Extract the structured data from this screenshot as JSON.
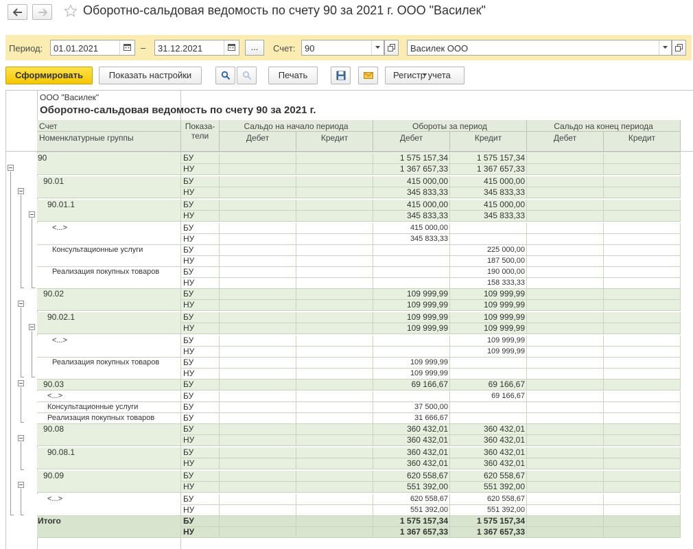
{
  "window": {
    "title": "Оборотно-сальдовая ведомость по счету 90 за 2021 г. ООО \"Василек\""
  },
  "filter": {
    "period_label": "Период:",
    "date_from": "01.01.2021",
    "date_to": "31.12.2021",
    "dash": "–",
    "ellipsis": "...",
    "account_label": "Счет:",
    "account_value": "90",
    "organization_value": "Василек ООО"
  },
  "toolbar": {
    "generate_label": "Сформировать",
    "settings_label": "Показать настройки",
    "print_label": "Печать",
    "register_label": "Регистр учета"
  },
  "report": {
    "org_name": "ООО \"Василек\"",
    "title": "Оборотно-сальдовая ведомость по счету 90 за 2021 г.",
    "headers": {
      "account": "Счет",
      "groups": "Номенклатурные группы",
      "indicators_1": "Показа-",
      "indicators_2": "тели",
      "opening": "Сальдо на начало периода",
      "turnover": "Обороты за период",
      "closing": "Сальдо на конец периода",
      "debit": "Дебет",
      "credit": "Кредит"
    },
    "rows": [
      {
        "label": "90",
        "ind": "БУ",
        "td": "1 575 157,34",
        "tc": "1 575 157,34"
      },
      {
        "label": "",
        "ind": "НУ",
        "td": "1 367 657,33",
        "tc": "1 367 657,33"
      },
      {
        "label": "90.01",
        "ind": "БУ",
        "td": "415 000,00",
        "tc": "415 000,00"
      },
      {
        "label": "",
        "ind": "НУ",
        "td": "345 833,33",
        "tc": "345 833,33"
      },
      {
        "label": "90.01.1",
        "ind": "БУ",
        "td": "415 000,00",
        "tc": "415 000,00"
      },
      {
        "label": "",
        "ind": "НУ",
        "td": "345 833,33",
        "tc": "345 833,33"
      },
      {
        "label": "<...>",
        "ind": "БУ",
        "td": "415 000,00",
        "tc": ""
      },
      {
        "label": "",
        "ind": "НУ",
        "td": "345 833,33",
        "tc": ""
      },
      {
        "label": "Консультационные услуги",
        "ind": "БУ",
        "td": "",
        "tc": "225 000,00"
      },
      {
        "label": "",
        "ind": "НУ",
        "td": "",
        "tc": "187 500,00"
      },
      {
        "label": "Реализация покупных товаров",
        "ind": "БУ",
        "td": "",
        "tc": "190 000,00"
      },
      {
        "label": "",
        "ind": "НУ",
        "td": "",
        "tc": "158 333,33"
      },
      {
        "label": "90.02",
        "ind": "БУ",
        "td": "109 999,99",
        "tc": "109 999,99"
      },
      {
        "label": "",
        "ind": "НУ",
        "td": "109 999,99",
        "tc": "109 999,99"
      },
      {
        "label": "90.02.1",
        "ind": "БУ",
        "td": "109 999,99",
        "tc": "109 999,99"
      },
      {
        "label": "",
        "ind": "НУ",
        "td": "109 999,99",
        "tc": "109 999,99"
      },
      {
        "label": "<...>",
        "ind": "БУ",
        "td": "",
        "tc": "109 999,99"
      },
      {
        "label": "",
        "ind": "НУ",
        "td": "",
        "tc": "109 999,99"
      },
      {
        "label": "Реализация покупных товаров",
        "ind": "БУ",
        "td": "109 999,99",
        "tc": ""
      },
      {
        "label": "",
        "ind": "НУ",
        "td": "109 999,99",
        "tc": ""
      },
      {
        "label": "90.03",
        "ind": "БУ",
        "td": "69 166,67",
        "tc": "69 166,67"
      },
      {
        "label": "<...>",
        "ind": "БУ",
        "td": "",
        "tc": "69 166,67"
      },
      {
        "label": "Консультационные услуги",
        "ind": "БУ",
        "td": "37 500,00",
        "tc": ""
      },
      {
        "label": "Реализация покупных товаров",
        "ind": "БУ",
        "td": "31 666,67",
        "tc": ""
      },
      {
        "label": "90.08",
        "ind": "БУ",
        "td": "360 432,01",
        "tc": "360 432,01"
      },
      {
        "label": "",
        "ind": "НУ",
        "td": "360 432,01",
        "tc": "360 432,01"
      },
      {
        "label": "90.08.1",
        "ind": "БУ",
        "td": "360 432,01",
        "tc": "360 432,01"
      },
      {
        "label": "",
        "ind": "НУ",
        "td": "360 432,01",
        "tc": "360 432,01"
      },
      {
        "label": "90.09",
        "ind": "БУ",
        "td": "620 558,67",
        "tc": "620 558,67"
      },
      {
        "label": "",
        "ind": "НУ",
        "td": "551 392,00",
        "tc": "551 392,00"
      },
      {
        "label": "<...>",
        "ind": "БУ",
        "td": "620 558,67",
        "tc": "620 558,67"
      },
      {
        "label": "",
        "ind": "НУ",
        "td": "551 392,00",
        "tc": "551 392,00"
      },
      {
        "label": "Итого",
        "ind": "БУ",
        "td": "1 575 157,34",
        "tc": "1 575 157,34"
      },
      {
        "label": "",
        "ind": "НУ",
        "td": "1 367 657,33",
        "tc": "1 367 657,33"
      }
    ]
  }
}
